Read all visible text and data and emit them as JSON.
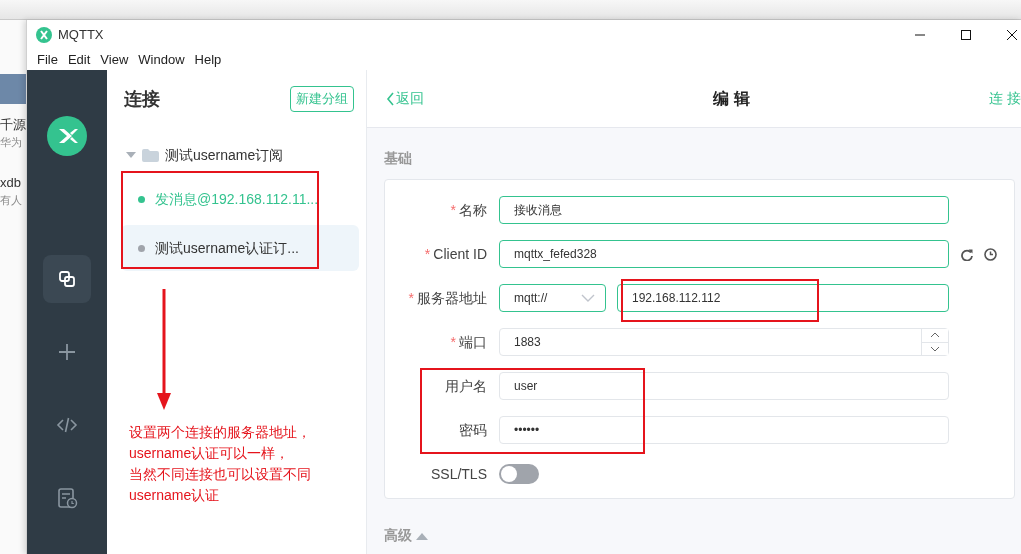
{
  "background_window": {
    "texts": [
      "千源",
      "华为",
      "xdb",
      "有人"
    ]
  },
  "window": {
    "title": "MQTTX"
  },
  "menu": [
    "File",
    "Edit",
    "View",
    "Window",
    "Help"
  ],
  "sidebar": {
    "items": [
      {
        "kind": "connections",
        "selected": true
      },
      {
        "kind": "new",
        "selected": false
      },
      {
        "kind": "script",
        "selected": false
      },
      {
        "kind": "log",
        "selected": false
      }
    ]
  },
  "connections": {
    "title": "连接",
    "new_group_button": "新建分组",
    "marked": true,
    "groups": [
      {
        "name": "测试username订阅",
        "expanded": true,
        "children": [
          {
            "name": "发消息@192.168.112.11...",
            "connected": true,
            "selected": false
          },
          {
            "name": "测试username认证订...",
            "connected": false,
            "selected": true
          }
        ]
      }
    ]
  },
  "annotation": {
    "lines": [
      "设置两个连接的服务器地址，",
      "username认证可以一样，",
      "当然不同连接也可以设置不同",
      "username认证"
    ]
  },
  "editor": {
    "back": "返回",
    "title": "编 辑",
    "connect": "连 接",
    "section": "基础",
    "fields": [
      {
        "kind": "text",
        "required_mark": "*",
        "label": "名称",
        "value": "接收消息",
        "validated": true
      },
      {
        "kind": "client_id",
        "required_mark": "*",
        "label": "Client ID",
        "value": "mqttx_fefed328",
        "validated": true
      },
      {
        "kind": "host",
        "required_mark": "*",
        "label": "服务器地址",
        "protocol": "mqtt://",
        "value": "192.168.112.112",
        "validated": true,
        "marked": true
      },
      {
        "kind": "number",
        "required_mark": "*",
        "label": "端口",
        "value": "1883",
        "validated": false
      },
      {
        "kind": "text",
        "label": "用户名",
        "value": "user",
        "validated": false,
        "marked": true
      },
      {
        "kind": "text",
        "label": "密码",
        "value": "••••••",
        "validated": false,
        "marked": true
      },
      {
        "kind": "switch",
        "label": "SSL/TLS",
        "on": false
      }
    ],
    "advanced": "高级"
  }
}
